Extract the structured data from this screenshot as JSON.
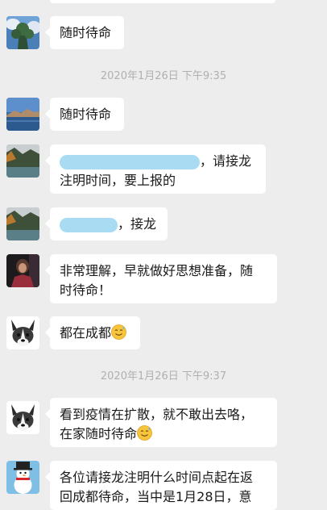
{
  "messages": [
    {
      "id": "m1",
      "text": "随时待命"
    },
    {
      "id": "m2",
      "text": "随时待命"
    },
    {
      "id": "m3",
      "line1_tail": "，请接龙",
      "line2": "注明时间，要上报的"
    },
    {
      "id": "m4",
      "tail": "，接龙"
    },
    {
      "id": "m5",
      "line1": "非常理解，早就做好思想准备，随",
      "line2": "时待命！"
    },
    {
      "id": "m6",
      "text": "都在成都"
    },
    {
      "id": "m7",
      "line1": "看到疫情在扩散，就不敢出去咯，",
      "line2": "在家随时待命"
    },
    {
      "id": "m8",
      "line1": "各位请接龙注明什么时间点起在返",
      "line2": "回成都待命，当中是1月28日，意"
    }
  ],
  "timestamps": {
    "t1": "2020年1月26日 下午9:35",
    "t2": "2020年1月26日 下午9:37"
  },
  "colors": {
    "background": "#ededed",
    "bubble": "#ffffff",
    "timestamp": "#b0b0b0",
    "redaction": "#a9dcf2"
  },
  "icons": {
    "avatar_tree": "avatar-tree-sky",
    "avatar_lake": "avatar-lake-mountain",
    "avatar_river": "avatar-river-forest",
    "avatar_person": "avatar-person-photo",
    "avatar_dog": "avatar-corgi",
    "avatar_snowman": "avatar-snowman",
    "emoji": "sweat-smile-emoji"
  }
}
